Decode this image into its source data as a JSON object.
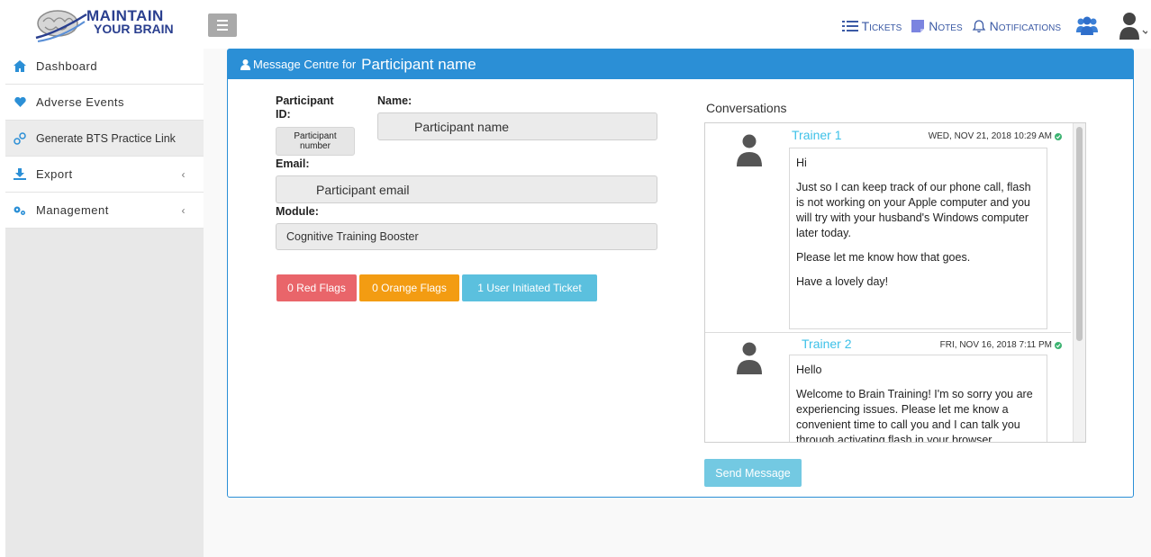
{
  "logo": {
    "line1": "MAINTAIN",
    "line2": "YOUR BRAIN"
  },
  "topnav": {
    "tickets": "Tickets",
    "notes": "Notes",
    "notifications": "Notifications"
  },
  "sidebar": {
    "items": [
      {
        "label": "Dashboard",
        "icon": "home-icon"
      },
      {
        "label": "Adverse Events",
        "icon": "heart-icon"
      },
      {
        "label": "Generate BTS Practice Link",
        "icon": "link-icon"
      },
      {
        "label": "Export",
        "icon": "download-icon",
        "chevron": "‹"
      },
      {
        "label": "Management",
        "icon": "gears-icon",
        "chevron": "‹"
      }
    ]
  },
  "panel": {
    "header_prefix": "Message Centre for",
    "header_name": "Participant name"
  },
  "form": {
    "participant_id_label": "Participant ID:",
    "participant_id_value": "Participant number",
    "name_label": "Name:",
    "name_value": "Participant name",
    "email_label": "Email:",
    "email_value": "Participant email",
    "module_label": "Module:",
    "module_value": "Cognitive Training Booster"
  },
  "flags": {
    "red": "0 Red Flags",
    "orange": "0 Orange Flags",
    "tickets": "1 User Initiated Ticket"
  },
  "conversations": {
    "title": "Conversations",
    "messages": [
      {
        "sender": "Trainer 1",
        "date": "WED, NOV 21, 2018 10:29 AM",
        "paragraphs": [
          "Hi",
          "Just so I can keep track of our phone call, flash is not working on your Apple computer and you will try with your husband's Windows computer later today.",
          "Please let me know how that goes.",
          "Have a lovely day!"
        ]
      },
      {
        "sender": "Trainer 2",
        "date": "FRI, NOV 16, 2018 7:11 PM",
        "paragraphs": [
          "Hello",
          "Welcome to Brain Training! I'm so sorry you are experiencing issues.  Please let me know a convenient time to call you  and I can talk you through activating flash in your browser."
        ]
      }
    ],
    "send_label": "Send Message"
  },
  "colors": {
    "primary": "#2b8fd6",
    "red_flag": "#e9656a",
    "orange_flag": "#f39c12",
    "info": "#5bc0de",
    "nav_blue": "#3b5aa5"
  }
}
